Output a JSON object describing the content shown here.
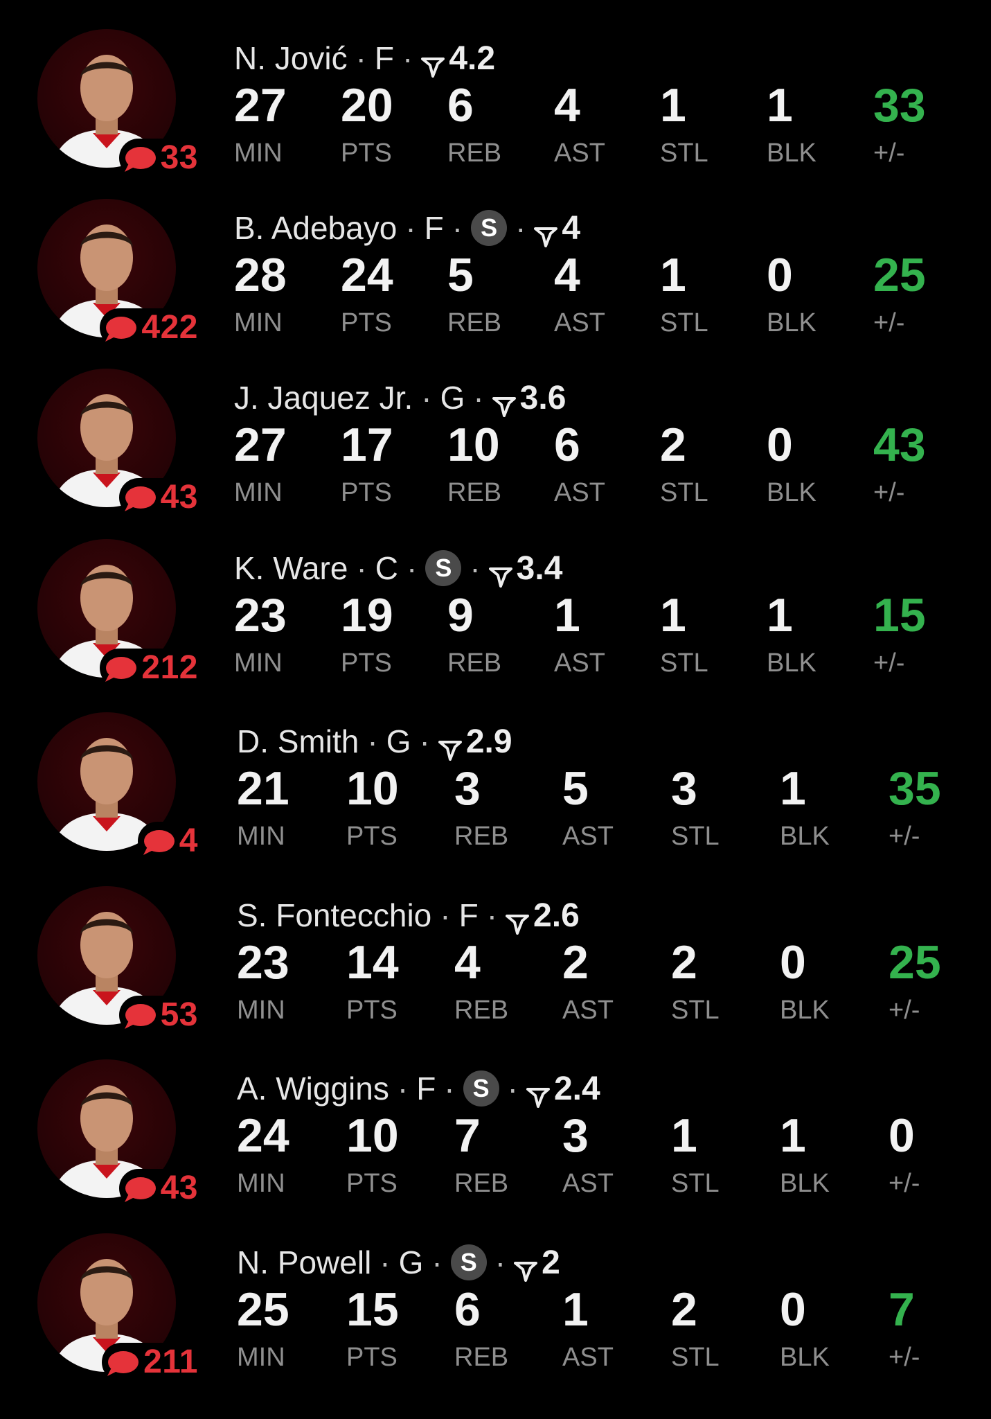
{
  "colors": {
    "background": "#000000",
    "positive": "#34b24e",
    "comment": "#e5333a",
    "label": "#8f8f8f",
    "starter_badge": "#4a4a4a"
  },
  "icons": {
    "comment": "speech-bubble-icon",
    "rating": "rating-icon",
    "starter": "starter-badge"
  },
  "players": [
    {
      "name": "N. Jović",
      "position": "F",
      "starter": false,
      "rating": "4.2",
      "comments": "33",
      "stats": {
        "min": "27",
        "pts": "20",
        "reb": "6",
        "ast": "4",
        "stl": "1",
        "blk": "1",
        "pm": "33"
      }
    },
    {
      "name": "B. Adebayo",
      "position": "F",
      "starter": true,
      "rating": "4",
      "comments": "422",
      "stats": {
        "min": "28",
        "pts": "24",
        "reb": "5",
        "ast": "4",
        "stl": "1",
        "blk": "0",
        "pm": "25"
      }
    },
    {
      "name": "J. Jaquez Jr.",
      "position": "G",
      "starter": false,
      "rating": "3.6",
      "comments": "43",
      "stats": {
        "min": "27",
        "pts": "17",
        "reb": "10",
        "ast": "6",
        "stl": "2",
        "blk": "0",
        "pm": "43"
      }
    },
    {
      "name": "K. Ware",
      "position": "C",
      "starter": true,
      "rating": "3.4",
      "comments": "212",
      "stats": {
        "min": "23",
        "pts": "19",
        "reb": "9",
        "ast": "1",
        "stl": "1",
        "blk": "1",
        "pm": "15"
      }
    },
    {
      "name": "D. Smith",
      "position": "G",
      "starter": false,
      "rating": "2.9",
      "comments": "4",
      "stats": {
        "min": "21",
        "pts": "10",
        "reb": "3",
        "ast": "5",
        "stl": "3",
        "blk": "1",
        "pm": "35"
      }
    },
    {
      "name": "S. Fontecchio",
      "position": "F",
      "starter": false,
      "rating": "2.6",
      "comments": "53",
      "stats": {
        "min": "23",
        "pts": "14",
        "reb": "4",
        "ast": "2",
        "stl": "2",
        "blk": "0",
        "pm": "25"
      }
    },
    {
      "name": "A. Wiggins",
      "position": "F",
      "starter": true,
      "rating": "2.4",
      "comments": "43",
      "stats": {
        "min": "24",
        "pts": "10",
        "reb": "7",
        "ast": "3",
        "stl": "1",
        "blk": "1",
        "pm": "0"
      }
    },
    {
      "name": "N. Powell",
      "position": "G",
      "starter": true,
      "rating": "2",
      "comments": "211",
      "stats": {
        "min": "25",
        "pts": "15",
        "reb": "6",
        "ast": "1",
        "stl": "2",
        "blk": "0",
        "pm": "7"
      }
    }
  ],
  "labels": {
    "separator": "·",
    "starter_letter": "S",
    "min": "MIN",
    "pts": "PTS",
    "reb": "REB",
    "ast": "AST",
    "stl": "STL",
    "blk": "BLK",
    "pm": "+/-"
  }
}
